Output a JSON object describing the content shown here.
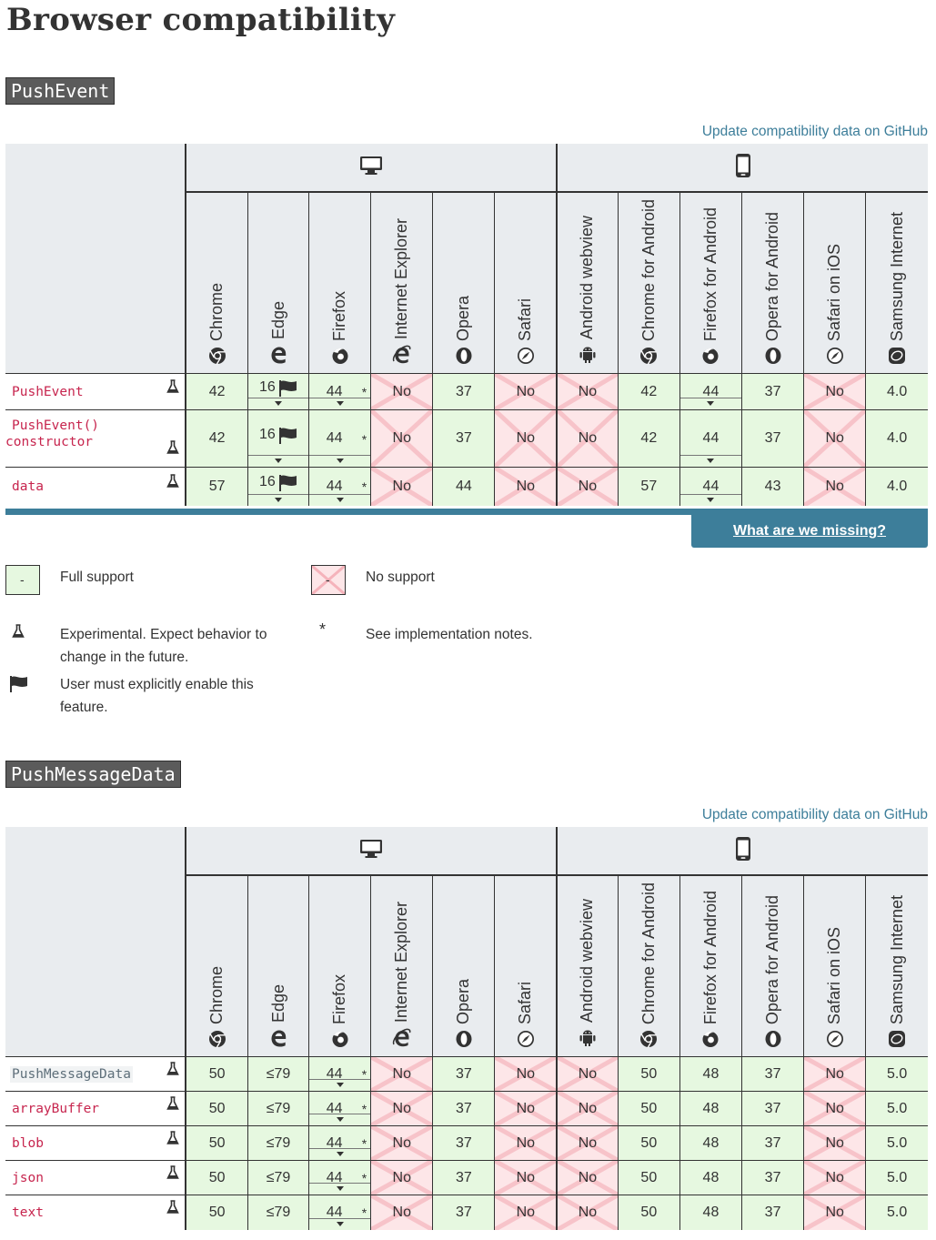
{
  "page_title": "Browser compatibility",
  "desktop_browsers": [
    "Chrome",
    "Edge",
    "Firefox",
    "Internet Explorer",
    "Opera",
    "Safari"
  ],
  "mobile_browsers": [
    "Android webview",
    "Chrome for Android",
    "Firefox for Android",
    "Opera for Android",
    "Safari on iOS",
    "Samsung Internet"
  ],
  "sections": [
    {
      "title": "PushEvent",
      "github_link": "Update compatibility data on GitHub",
      "rows": [
        {
          "feature": "PushEvent",
          "cells": [
            "42",
            "16",
            "44",
            "No",
            "37",
            "No",
            "No",
            "42",
            "44",
            "37",
            "No",
            "4.0"
          ]
        },
        {
          "feature": "PushEvent() constructor",
          "cells": [
            "42",
            "16",
            "44",
            "No",
            "37",
            "No",
            "No",
            "42",
            "44",
            "37",
            "No",
            "4.0"
          ]
        },
        {
          "feature": "data",
          "cells": [
            "57",
            "16",
            "44",
            "No",
            "44",
            "No",
            "No",
            "57",
            "44",
            "43",
            "No",
            "4.0"
          ]
        }
      ],
      "missing_button": "What are we missing?"
    },
    {
      "title": "PushMessageData",
      "github_link": "Update compatibility data on GitHub",
      "rows": [
        {
          "feature": "PushMessageData",
          "cells": [
            "50",
            "≤79",
            "44",
            "No",
            "37",
            "No",
            "No",
            "50",
            "48",
            "37",
            "No",
            "5.0"
          ]
        },
        {
          "feature": "arrayBuffer",
          "cells": [
            "50",
            "≤79",
            "44",
            "No",
            "37",
            "No",
            "No",
            "50",
            "48",
            "37",
            "No",
            "5.0"
          ]
        },
        {
          "feature": "blob",
          "cells": [
            "50",
            "≤79",
            "44",
            "No",
            "37",
            "No",
            "No",
            "50",
            "48",
            "37",
            "No",
            "5.0"
          ]
        },
        {
          "feature": "json",
          "cells": [
            "50",
            "≤79",
            "44",
            "No",
            "37",
            "No",
            "No",
            "50",
            "48",
            "37",
            "No",
            "5.0"
          ]
        },
        {
          "feature": "text",
          "cells": [
            "50",
            "≤79",
            "44",
            "No",
            "37",
            "No",
            "No",
            "50",
            "48",
            "37",
            "No",
            "5.0"
          ]
        }
      ]
    }
  ],
  "legend": {
    "full_support": "Full support",
    "no_support": "No support",
    "box_mark": "-",
    "experimental": "Experimental. Expect behavior to change in the future.",
    "implementation_notes": "See implementation notes.",
    "flag": "User must explicitly enable this feature."
  },
  "colors": {
    "yes_bg": "#e6f8e0",
    "no_bg": "#fde6e8",
    "accent": "#3d7e9a"
  },
  "icons": [
    "desktop-icon",
    "mobile-icon",
    "flask-icon",
    "flag-icon",
    "star-icon",
    "chrome-icon",
    "edge-icon",
    "firefox-icon",
    "ie-icon",
    "opera-icon",
    "safari-icon",
    "android-icon",
    "samsung-icon"
  ]
}
